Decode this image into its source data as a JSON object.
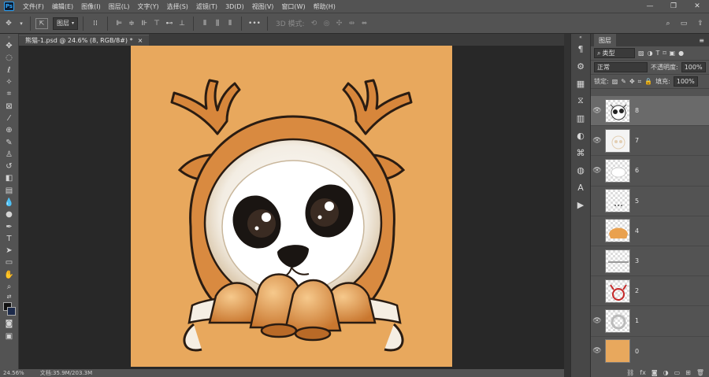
{
  "app": {
    "logo": "Ps"
  },
  "menu": [
    "文件(F)",
    "编辑(E)",
    "图像(I)",
    "图层(L)",
    "文字(Y)",
    "选择(S)",
    "滤镜(T)",
    "3D(D)",
    "视图(V)",
    "窗口(W)",
    "帮助(H)"
  ],
  "window_controls": [
    "—",
    "❐",
    "✕"
  ],
  "options": {
    "select_target": "图层",
    "mode_3d": "3D 模式:",
    "more": "•••"
  },
  "document": {
    "tab_title": "熊猫-1.psd @ 24.6% (8, RGB/8#) *",
    "close": "×"
  },
  "status": {
    "zoom": "24.56%",
    "doc_size": "文档:35.9M/203.3M"
  },
  "panel": {
    "title": "图层",
    "filter_label": "类型",
    "blend_mode": "正常",
    "opacity_label": "不透明度:",
    "opacity": "100%",
    "lock_label": "锁定:",
    "fill_label": "填充:",
    "fill": "100%"
  },
  "layers": [
    {
      "name": "8",
      "visible": true,
      "selected": true,
      "thumb": "panda-lineart"
    },
    {
      "name": "7",
      "visible": true,
      "selected": false,
      "thumb": "faint-sketch"
    },
    {
      "name": "6",
      "visible": true,
      "selected": false,
      "thumb": "white-oval"
    },
    {
      "name": "5",
      "visible": false,
      "selected": false,
      "thumb": "dots"
    },
    {
      "name": "4",
      "visible": false,
      "selected": false,
      "thumb": "orange-hood"
    },
    {
      "name": "3",
      "visible": false,
      "selected": false,
      "thumb": "grey-band"
    },
    {
      "name": "2",
      "visible": false,
      "selected": false,
      "thumb": "red-antlers"
    },
    {
      "name": "1",
      "visible": true,
      "selected": false,
      "thumb": "white-ring"
    },
    {
      "name": "0",
      "visible": true,
      "selected": false,
      "thumb": "orange-bg"
    }
  ],
  "colors": {
    "accent": "#2fa3f6",
    "artboard_bg": "#e8a85d",
    "canvas_bg": "#282828",
    "ui_bg": "#535353"
  }
}
